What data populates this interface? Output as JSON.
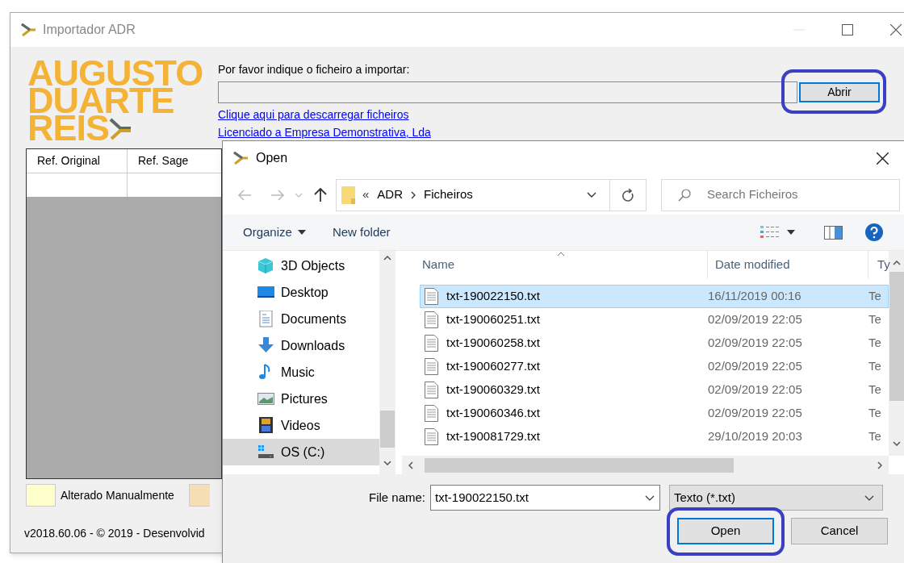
{
  "main_window": {
    "title": "Importador ADR",
    "logo": [
      "AUGUSTO",
      "DUARTE",
      "REIS"
    ],
    "prompt": "Por favor indique o ficheiro a importar:",
    "open_button": {
      "label": "Abrir",
      "highlighted": true
    },
    "download_link": "Clique aqui para descarregar ficheiros",
    "license": "Licenciado a Empresa Demonstrativa, Lda",
    "grid": {
      "columns": [
        "Ref. Original",
        "Ref. Sage"
      ]
    },
    "legend": [
      {
        "label": "Alterado Manualmente",
        "color": "#ffffcc"
      },
      {
        "color": "#f5deb3"
      }
    ],
    "footer": "v2018.60.06 - © 2019 - Desenvolvid"
  },
  "open_dialog": {
    "title": "Open",
    "breadcrumb": {
      "overflow_mark": "«",
      "parts": [
        "ADR",
        "Ficheiros"
      ]
    },
    "search": {
      "placeholder": "Search Ficheiros"
    },
    "toolbar": [
      {
        "label": "Organize",
        "dropdown": true
      },
      {
        "label": "New folder",
        "dropdown": false
      }
    ],
    "nav_items": [
      {
        "label": "3D Objects",
        "kind": "cube",
        "selected": false
      },
      {
        "label": "Desktop",
        "kind": "desktop",
        "selected": false
      },
      {
        "label": "Documents",
        "kind": "documents",
        "selected": false
      },
      {
        "label": "Downloads",
        "kind": "downloads",
        "selected": false
      },
      {
        "label": "Music",
        "kind": "music",
        "selected": false
      },
      {
        "label": "Pictures",
        "kind": "pictures",
        "selected": false
      },
      {
        "label": "Videos",
        "kind": "videos",
        "selected": false
      },
      {
        "label": "OS (C:)",
        "kind": "drive",
        "selected": true
      }
    ],
    "columns": [
      "Name",
      "Date modified",
      "Ty"
    ],
    "files": [
      {
        "name": "txt-190022150.txt",
        "date": "16/11/2019 00:16",
        "type": "Te",
        "selected": true
      },
      {
        "name": "txt-190060251.txt",
        "date": "02/09/2019 22:05",
        "type": "Te",
        "selected": false
      },
      {
        "name": "txt-190060258.txt",
        "date": "02/09/2019 22:05",
        "type": "Te",
        "selected": false
      },
      {
        "name": "txt-190060277.txt",
        "date": "02/09/2019 22:05",
        "type": "Te",
        "selected": false
      },
      {
        "name": "txt-190060329.txt",
        "date": "02/09/2019 22:05",
        "type": "Te",
        "selected": false
      },
      {
        "name": "txt-190060346.txt",
        "date": "02/09/2019 22:05",
        "type": "Te",
        "selected": false
      },
      {
        "name": "txt-190081729.txt",
        "date": "29/10/2019 20:03",
        "type": "Te",
        "selected": false
      }
    ],
    "file_name_label": "File name:",
    "file_name": {
      "value": "txt-190022150.txt"
    },
    "file_type": {
      "value": "Texto (*.txt)"
    },
    "buttons": [
      {
        "label": "Open",
        "highlighted": true,
        "default": true
      },
      {
        "label": "Cancel",
        "highlighted": false,
        "default": false
      }
    ]
  }
}
